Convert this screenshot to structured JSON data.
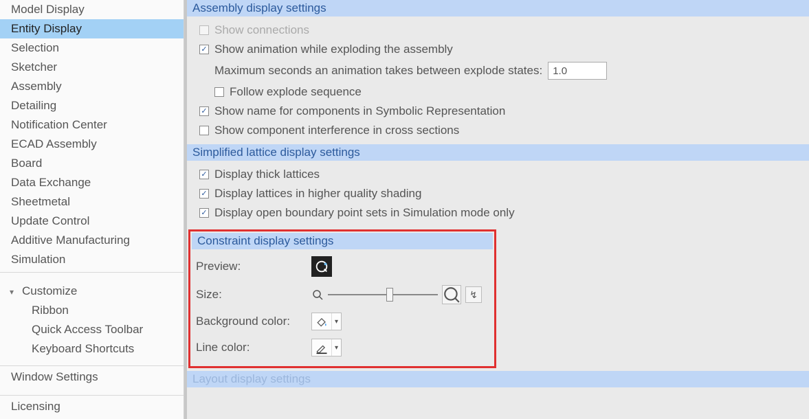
{
  "sidebar": {
    "items": [
      "Model Display",
      "Entity Display",
      "Selection",
      "Sketcher",
      "Assembly",
      "Detailing",
      "Notification Center",
      "ECAD Assembly",
      "Board",
      "Data Exchange",
      "Sheetmetal",
      "Update Control",
      "Additive Manufacturing",
      "Simulation"
    ],
    "selected_index": 1,
    "customize": {
      "label": "Customize",
      "children": [
        "Ribbon",
        "Quick Access Toolbar",
        "Keyboard Shortcuts"
      ]
    },
    "window_settings": "Window Settings",
    "licensing": "Licensing"
  },
  "sections": {
    "assembly": {
      "title": "Assembly display settings",
      "show_connections": {
        "label": "Show connections",
        "checked": false,
        "enabled": false
      },
      "show_animation": {
        "label": "Show animation while exploding the assembly",
        "checked": true
      },
      "max_seconds": {
        "label": "Maximum seconds an animation takes between explode states:",
        "value": "1.0"
      },
      "follow_explode": {
        "label": "Follow explode sequence",
        "checked": false
      },
      "show_name_symbolic": {
        "label": "Show name for components in Symbolic Representation",
        "checked": true
      },
      "show_interference": {
        "label": "Show component interference in cross sections",
        "checked": false
      }
    },
    "lattice": {
      "title": "Simplified lattice display settings",
      "thick": {
        "label": "Display thick lattices",
        "checked": true
      },
      "hq": {
        "label": "Display lattices in higher quality shading",
        "checked": true
      },
      "open_boundary": {
        "label": "Display open boundary point sets in Simulation mode only",
        "checked": true
      }
    },
    "constraint": {
      "title": "Constraint display settings",
      "preview_label": "Preview:",
      "size_label": "Size:",
      "background_label": "Background color:",
      "line_label": "Line color:",
      "reset_glyph": "↯"
    },
    "bottom_cutoff": "Layout display settings"
  }
}
